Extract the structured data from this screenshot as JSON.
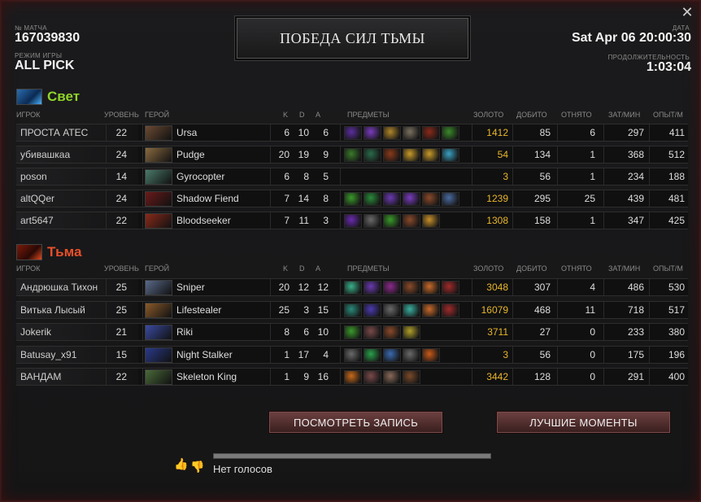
{
  "header": {
    "match_id_label": "№ МАТЧА",
    "match_id": "167039830",
    "mode_label": "РЕЖИМ ИГРЫ",
    "mode": "ALL PICK",
    "title": "ПОБЕДА СИЛ ТЬМЫ",
    "date_label": "ДАТА",
    "date": "Sat Apr 06 20:00:30",
    "duration_label": "ПРОДОЛЖИТЕЛЬНОСТЬ",
    "duration": "1:03:04",
    "close_icon": "close-icon"
  },
  "columns": {
    "player": "ИГРОК",
    "level": "УРОВЕНЬ",
    "hero": "ГЕРОЙ",
    "k": "K",
    "d": "D",
    "a": "A",
    "items": "ПРЕДМЕТЫ",
    "gold": "ЗОЛОТО",
    "lh": "ДОБИТО",
    "dn": "ОТНЯТО",
    "gpm": "ЗАТ/МИН",
    "xpm": "ОПЫТ/М"
  },
  "radiant": {
    "name": "Свет",
    "color": "#8fd42a",
    "players": [
      {
        "player": "ПРОСТА АТЕС",
        "level": "22",
        "hero": "Ursa",
        "k": "6",
        "d": "10",
        "a": "6",
        "gold": "1412",
        "lh": "85",
        "dn": "6",
        "gpm": "297",
        "xpm": "411",
        "hero_color": "#6b4a33",
        "items": [
          "#5b2ea0",
          "#7a3cc0",
          "#b0862a",
          "#7a7060",
          "#8a2a1a",
          "#3a8a2a"
        ]
      },
      {
        "player": "убивашкаа",
        "level": "24",
        "hero": "Pudge",
        "k": "20",
        "d": "19",
        "a": "9",
        "gold": "54",
        "lh": "134",
        "dn": "1",
        "gpm": "368",
        "xpm": "512",
        "hero_color": "#8a6a40",
        "items": [
          "#3a7a2a",
          "#2a6a4a",
          "#8a3a1a",
          "#c89a2a",
          "#c89a2a",
          "#3aa0c0"
        ]
      },
      {
        "player": "poson",
        "level": "14",
        "hero": "Gyrocopter",
        "k": "6",
        "d": "8",
        "a": "5",
        "gold": "3",
        "lh": "56",
        "dn": "1",
        "gpm": "234",
        "xpm": "188",
        "hero_color": "#4a7a6a",
        "items": []
      },
      {
        "player": "altQQer",
        "level": "24",
        "hero": "Shadow Fiend",
        "k": "7",
        "d": "14",
        "a": "8",
        "gold": "1239",
        "lh": "295",
        "dn": "25",
        "gpm": "439",
        "xpm": "481",
        "hero_color": "#6a1a1a",
        "items": [
          "#3a9a2a",
          "#2a8a3a",
          "#6a3ab0",
          "#7a3cc0",
          "#8a4a2a",
          "#4a6aa0"
        ]
      },
      {
        "player": "art5647",
        "level": "22",
        "hero": "Bloodseeker",
        "k": "7",
        "d": "11",
        "a": "3",
        "gold": "1308",
        "lh": "158",
        "dn": "1",
        "gpm": "347",
        "xpm": "425",
        "hero_color": "#8a2a1a",
        "items": [
          "#6a2ab0",
          "#6a6a6a",
          "#3a9a2a",
          "#8a4a2a",
          "#c8902a"
        ]
      }
    ]
  },
  "dire": {
    "name": "Тьма",
    "color": "#e8502a",
    "players": [
      {
        "player": "Андрюшка Тихон",
        "level": "25",
        "hero": "Sniper",
        "k": "20",
        "d": "12",
        "a": "12",
        "gold": "3048",
        "lh": "307",
        "dn": "4",
        "gpm": "486",
        "xpm": "530",
        "hero_color": "#5a6a8a",
        "items": [
          "#3ab08a",
          "#6a3ab0",
          "#8a2a8a",
          "#8a4a2a",
          "#c86a2a",
          "#a02a2a"
        ]
      },
      {
        "player": "Витька Лысый",
        "level": "25",
        "hero": "Lifestealer",
        "k": "25",
        "d": "3",
        "a": "15",
        "gold": "16079",
        "lh": "468",
        "dn": "11",
        "gpm": "718",
        "xpm": "517",
        "hero_color": "#8a5a2a",
        "items": [
          "#2a8a7a",
          "#4a3ab0",
          "#6a6a6a",
          "#3ab0a0",
          "#c86a2a",
          "#a02a2a"
        ]
      },
      {
        "player": "Jokerik",
        "level": "21",
        "hero": "Riki",
        "k": "8",
        "d": "6",
        "a": "10",
        "gold": "3711",
        "lh": "27",
        "dn": "0",
        "gpm": "233",
        "xpm": "380",
        "hero_color": "#3a4aa0",
        "items": [
          "#3a9a2a",
          "#7a4a4a",
          "#8a4a2a",
          "#b0a02a"
        ]
      },
      {
        "player": "Batusay_x91",
        "level": "15",
        "hero": "Night Stalker",
        "k": "1",
        "d": "17",
        "a": "4",
        "gold": "3",
        "lh": "56",
        "dn": "0",
        "gpm": "175",
        "xpm": "196",
        "hero_color": "#2a3a8a",
        "items": [
          "#6a6a6a",
          "#2aa04a",
          "#3a6ab0",
          "#6a6a6a",
          "#c85a1a"
        ]
      },
      {
        "player": "ВАНДАМ",
        "level": "22",
        "hero": "Skeleton King",
        "k": "1",
        "d": "9",
        "a": "16",
        "gold": "3442",
        "lh": "128",
        "dn": "0",
        "gpm": "291",
        "xpm": "400",
        "hero_color": "#4a6a3a",
        "items": [
          "#c86a1a",
          "#7a4a4a",
          "#8a6a5a",
          "#7a4a2a"
        ]
      }
    ]
  },
  "buttons": {
    "watch": "ПОСМОТРЕТЬ ЗАПИСЬ",
    "highlights": "ЛУЧШИЕ МОМЕНТЫ"
  },
  "votes": {
    "label": "Нет голосов",
    "up_icon": "thumbs-up-icon",
    "down_icon": "thumbs-down-icon"
  }
}
